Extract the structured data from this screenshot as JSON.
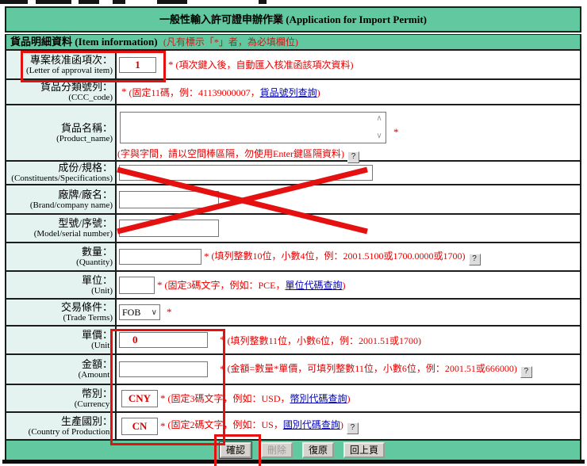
{
  "title_bar": {
    "text": "一般性輸入許可證申辦作業 (Application for Import Permit)"
  },
  "section_bar": {
    "title": "貨品明細資料 (Item information)",
    "required_note": "(凡有標示「*」者，為必填欄位)"
  },
  "asterisk": "*",
  "icons": {
    "help": "?",
    "select_arrow": "∨",
    "scroll_up": "∧",
    "scroll_down": "∨"
  },
  "colors": {
    "teal_bar": "#62c8a0",
    "label_bg": "#e4f3f0",
    "annotation_red": "#e51111",
    "note_red": "#e60000",
    "value_red": "#d40000",
    "link_blue": "#0000bb"
  },
  "rows": [
    {
      "label_zh": "專案核准函項次：",
      "label_en": "(Letter of approval item)",
      "value": "1",
      "note": "(項次鍵入後，自動匯入核准函該項次資料)"
    },
    {
      "label_zh": "貨品分類號列：",
      "label_en": "(CCC_code)",
      "note_pre": "(固定11碼，例：41139000007，",
      "link": "貨品號列查詢",
      "note_post": ")"
    },
    {
      "label_zh": "貨品名稱：",
      "label_en": "(Product_name)",
      "value": "",
      "note": "(字與字間，請以空間棒區隔，勿使用Enter鍵區隔資料)"
    },
    {
      "label_zh": "成份/規格：",
      "label_en": "(Constituents/Specifications)",
      "value": ""
    },
    {
      "label_zh": "廠牌/廠名：",
      "label_en": "(Brand/company name)",
      "value": ""
    },
    {
      "label_zh": "型號/序號：",
      "label_en": "(Model/serial number)",
      "value": ""
    },
    {
      "label_zh": "數量：",
      "label_en": "(Quantity)",
      "value": "",
      "note": "(填列整數10位，小數4位，例：2001.5100或1700.0000或1700)"
    },
    {
      "label_zh": "單位：",
      "label_en": "(Unit)",
      "value": "",
      "note_pre": "(固定3碼文字，例如：PCE，",
      "link": "單位代碼查詢",
      "note_post": ")"
    },
    {
      "label_zh": "交易條件：",
      "label_en": "(Trade Terms)",
      "select_value": "FOB"
    },
    {
      "label_zh": "單價：",
      "label_en": "(Unit)",
      "value": "0",
      "note": "(填列整數11位，小數6位，例：2001.51或1700)"
    },
    {
      "label_zh": "金額：",
      "label_en": "(Amount)",
      "value": "",
      "note": "(金額=數量*單價，可填列整數11位，小數6位，例：2001.51或666000)"
    },
    {
      "label_zh": "幣別：",
      "label_en": "(Currency)",
      "value": "CNY",
      "note_pre": "(固定3碼文字，例如：USD，",
      "link": "幣別代碼查詢",
      "note_post": ")"
    },
    {
      "label_zh": "生產國別：",
      "label_en": "(Country of Production)",
      "value": "CN",
      "note_pre": "(固定2碼文字，例如：US，",
      "link": "國別代碼查詢",
      "note_post": ")"
    }
  ],
  "buttons": {
    "confirm": "確認",
    "delete": "刪除",
    "restore": "復原",
    "back": "回上頁"
  }
}
